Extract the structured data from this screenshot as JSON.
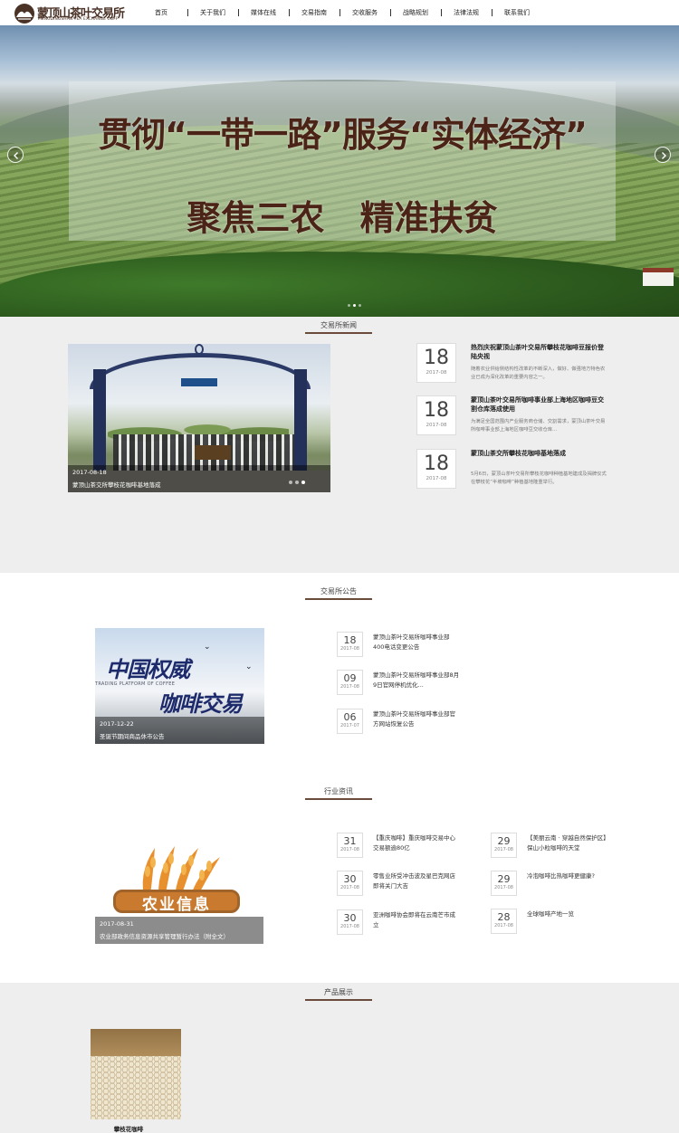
{
  "brand": {
    "name_cn": "蒙顶山茶叶交易所",
    "name_en": "MENGDINGSHAN TEA EXCHANGE COFF"
  },
  "nav": [
    "首页",
    "关于我们",
    "媒体在线",
    "交易指南",
    "交收服务",
    "战略规划",
    "法律法规",
    "联系我们"
  ],
  "banner": {
    "line1": "贯彻“一带一路”服务“实体经济”",
    "line2": "聚焦三农 精准扶贫"
  },
  "news": {
    "section_title": "交易所新闻",
    "featured": {
      "date": "2017-08-18",
      "caption": "蒙顶山茶交所攀枝花咖啡基地落成"
    },
    "items": [
      {
        "day": "18",
        "ym": "2017-08",
        "title": "热烈庆祝蒙顶山茶叶交易所攀枝花咖啡豆报价登陆央视",
        "desc": "随着农业供给侧结构性改革的不断深入，做好、做强地方特色农业已成为深化改革的重要内容之一。"
      },
      {
        "day": "18",
        "ym": "2017-08",
        "title": "蒙顶山茶叶交易所咖啡事业部上海地区咖啡豆交割仓库落成使用",
        "desc": "为满足全国范围内产业服务商仓储、交割需求，蒙顶山茶叶交易所咖啡事业部上海地区咖啡豆交收仓库..."
      },
      {
        "day": "18",
        "ym": "2017-08",
        "title": "蒙顶山茶交所攀枝花咖啡基地落成",
        "desc": "5月6日，蒙顶山茶叶交易所攀枝花咖啡种植基地建成及揭牌仪式在攀枝花“半坡咖啡”种植基地隆重举行。"
      }
    ]
  },
  "announcements": {
    "section_title": "交易所公告",
    "featured": {
      "date": "2017-12-22",
      "caption": "圣诞节期间商品休市公告",
      "image_text_1": "中国权威",
      "image_text_2": "咖啡交易",
      "image_text_en": "TRADING PLATFORM OF COFFEE"
    },
    "items": [
      {
        "day": "18",
        "ym": "2017-08",
        "title": "蒙顶山茶叶交易所咖啡事业部400电话变更公告"
      },
      {
        "day": "09",
        "ym": "2017-08",
        "title": "蒙顶山茶叶交易所咖啡事业部8月9日官网停机优化..."
      },
      {
        "day": "06",
        "ym": "2017-07",
        "title": "蒙顶山茶叶交易所咖啡事业部官方网站恢复公告"
      }
    ]
  },
  "industry": {
    "section_title": "行业资讯",
    "featured": {
      "date": "2017-08-31",
      "caption": "农业部政务信息资源共享管理暂行办法（附全文）",
      "image_text": "农业信息"
    },
    "left_items": [
      {
        "day": "31",
        "ym": "2017-08",
        "title": "【重庆咖啡】重庆咖啡交易中心交易额逾80亿"
      },
      {
        "day": "30",
        "ym": "2017-08",
        "title": "零售业所受冲击波及星巴克网店即将关门大吉"
      },
      {
        "day": "30",
        "ym": "2017-08",
        "title": "亚洲咖啡协会即将在云南芒市成立"
      }
    ],
    "right_items": [
      {
        "day": "29",
        "ym": "2017-08",
        "title": "【美丽云南 · 穿越自然保护区】保山小粒咖啡的天堂"
      },
      {
        "day": "29",
        "ym": "2017-08",
        "title": "冷泡咖啡比热咖啡更健康?"
      },
      {
        "day": "28",
        "ym": "2017-08",
        "title": "全球咖啡产地一览"
      }
    ]
  },
  "products": {
    "section_title": "产品展示",
    "items": [
      {
        "name": "攀枝花咖啡"
      }
    ]
  },
  "colors": {
    "accent": "#6b4b3c",
    "banner_text": "#4b2317",
    "section_bg": "#eeeeee"
  },
  "icons": [
    "logo-mark-icon",
    "chevron-left-icon",
    "chevron-right-icon",
    "bird-icon",
    "wheat-icon"
  ]
}
